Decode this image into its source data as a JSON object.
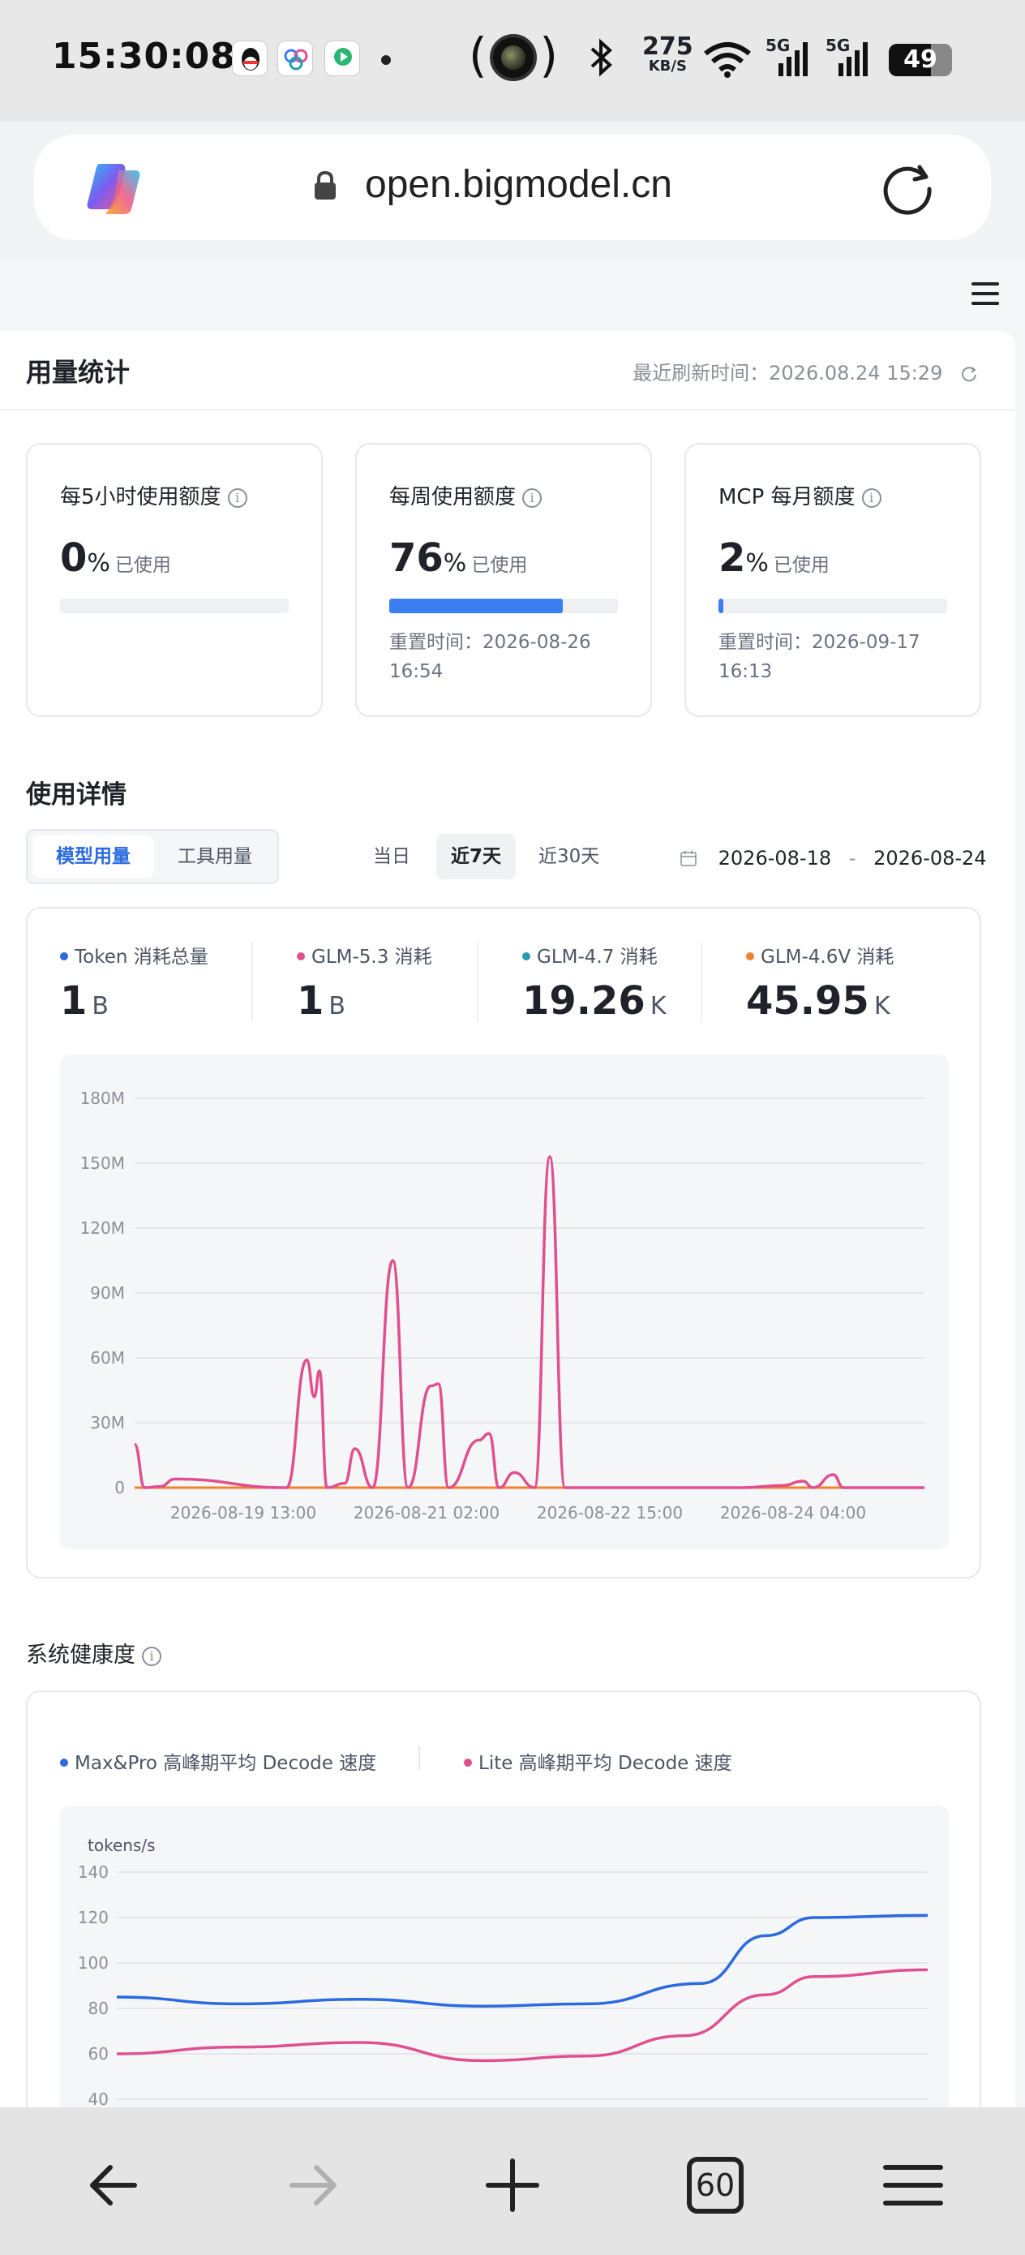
{
  "status_bar": {
    "time": "15:30:08",
    "net_speed_value": "275",
    "net_speed_unit": "KB/S",
    "signal1": "5G",
    "signal2": "5G",
    "battery": "49"
  },
  "browser": {
    "url": "open.bigmodel.cn",
    "tab_count": "60"
  },
  "usage": {
    "title": "用量统计",
    "refresh_label": "最近刷新时间：2026.08.24 15:29",
    "quotas": [
      {
        "title": "每5小时使用额度",
        "value": "0",
        "pct": "%",
        "used": "已使用",
        "progress": 0,
        "reset": ""
      },
      {
        "title": "每周使用额度",
        "value": "76",
        "pct": "%",
        "used": "已使用",
        "progress": 76,
        "reset": "重置时间：2026-08-26 16:54"
      },
      {
        "title": "MCP 每月额度",
        "value": "2",
        "pct": "%",
        "used": "已使用",
        "progress": 2,
        "reset": "重置时间：2026-09-17 16:13"
      }
    ]
  },
  "details": {
    "title": "使用详情",
    "tabs": [
      "模型用量",
      "工具用量"
    ],
    "active_tab": 0,
    "ranges": [
      "当日",
      "近7天",
      "近30天"
    ],
    "active_range": 1,
    "date_start": "2026-08-18",
    "date_sep": "-",
    "date_end": "2026-08-24",
    "stats": [
      {
        "label": "Token 消耗总量",
        "value": "1",
        "unit": "B",
        "color": "#2b6ae0"
      },
      {
        "label": "GLM-5.3 消耗",
        "value": "1",
        "unit": "B",
        "color": "#e0508f"
      },
      {
        "label": "GLM-4.7 消耗",
        "value": "19.26",
        "unit": "K",
        "color": "#1fa0a8"
      },
      {
        "label": "GLM-4.6V 消耗",
        "value": "45.95",
        "unit": "K",
        "color": "#f0822e"
      }
    ]
  },
  "health": {
    "title": "系统健康度",
    "legend": [
      {
        "label": "Max&Pro 高峰期平均 Decode 速度",
        "color": "#2b6ae0"
      },
      {
        "label": "Lite 高峰期平均 Decode 速度",
        "color": "#e0508f"
      }
    ]
  },
  "chart_data": [
    {
      "type": "line",
      "yticks": [
        "180M",
        "150M",
        "120M",
        "90M",
        "60M",
        "30M",
        "0"
      ],
      "ylim": [
        0,
        180
      ],
      "xticks": [
        "2026-08-19 13:00",
        "2026-08-21 02:00",
        "2026-08-22 15:00",
        "2026-08-24 04:00"
      ],
      "x_range": [
        0,
        156
      ],
      "series": [
        {
          "name": "GLM-5.3",
          "color": "#e0508f",
          "peaks": [
            [
              0,
              20
            ],
            [
              2,
              0
            ],
            [
              5,
              0.5
            ],
            [
              8,
              4
            ],
            [
              30,
              0
            ],
            [
              34,
              59
            ],
            [
              35.5,
              42
            ],
            [
              36.5,
              54
            ],
            [
              38,
              0
            ],
            [
              41.5,
              2
            ],
            [
              43.5,
              18
            ],
            [
              47,
              0
            ],
            [
              51,
              105
            ],
            [
              54,
              0
            ],
            [
              58.5,
              47
            ],
            [
              60,
              48
            ],
            [
              62,
              0
            ],
            [
              68,
              22
            ],
            [
              70,
              25
            ],
            [
              72,
              0
            ],
            [
              75,
              7
            ],
            [
              79,
              0
            ],
            [
              82,
              153
            ],
            [
              85,
              0
            ],
            [
              120,
              0
            ],
            [
              128,
              1
            ],
            [
              132,
              3
            ],
            [
              134,
              0
            ],
            [
              138,
              6
            ],
            [
              140,
              0
            ],
            [
              156,
              0
            ]
          ]
        },
        {
          "name": "GLM-4.6V",
          "color": "#f0822e",
          "flat": 0
        }
      ]
    },
    {
      "type": "line",
      "ylabel": "tokens/s",
      "yticks": [
        "140",
        "120",
        "100",
        "80",
        "60",
        "40"
      ],
      "ylim": [
        40,
        140
      ],
      "series": [
        {
          "name": "Max&Pro 高峰期平均 Decode 速度",
          "color": "#2b6ae0",
          "values": [
            [
              0,
              85
            ],
            [
              15,
              82
            ],
            [
              30,
              84
            ],
            [
              45,
              81
            ],
            [
              58,
              82
            ],
            [
              72,
              91
            ],
            [
              80,
              112
            ],
            [
              86,
              120
            ],
            [
              100,
              121
            ]
          ]
        },
        {
          "name": "Lite 高峰期平均 Decode 速度",
          "color": "#e0508f",
          "values": [
            [
              0,
              60
            ],
            [
              15,
              63
            ],
            [
              30,
              65
            ],
            [
              45,
              57
            ],
            [
              58,
              59
            ],
            [
              70,
              68
            ],
            [
              80,
              86
            ],
            [
              86,
              94
            ],
            [
              100,
              97
            ]
          ]
        }
      ]
    }
  ]
}
